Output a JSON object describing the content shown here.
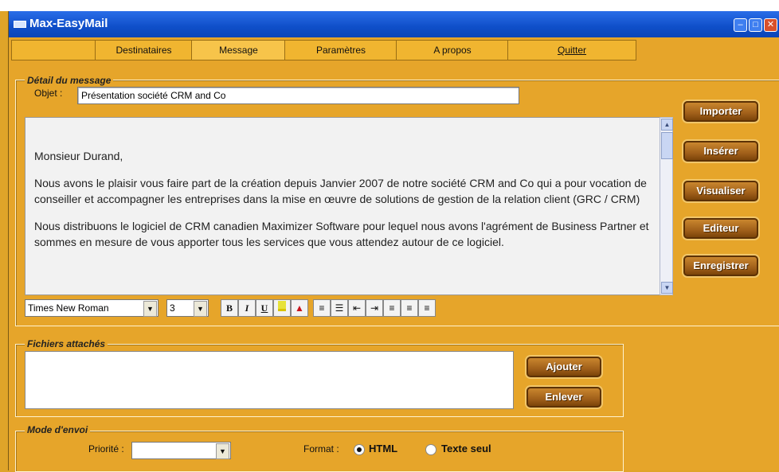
{
  "window": {
    "title": "Max-EasyMail"
  },
  "menu": {
    "items": [
      {
        "label": "Destinataires"
      },
      {
        "label": "Message"
      },
      {
        "label": "Paramètres"
      },
      {
        "label": "A propos"
      },
      {
        "label": "Quitter"
      }
    ],
    "active": "Message"
  },
  "message_detail": {
    "legend": "Détail du message",
    "subject_label": "Objet :",
    "subject_value": "Présentation société CRM and Co",
    "body_paragraphs": [
      "Monsieur Durand,",
      "Nous avons le plaisir vous faire part de la création depuis Janvier 2007 de notre  société CRM and Co qui a pour vocation de conseiller et accompagner les entreprises dans la mise en œuvre de solutions de gestion de la relation client (GRC / CRM)",
      "Nous distribuons le logiciel de CRM canadien Maximizer Software pour lequel nous avons l'agrément de Business Partner  et sommes en mesure de vous apporter tous les services que vous attendez autour de ce logiciel."
    ]
  },
  "side_buttons": {
    "importer": "Importer",
    "inserer": "Insérer",
    "visualiser": "Visualiser",
    "editeur": "Editeur",
    "enregistrer": "Enregistrer"
  },
  "format_toolbar": {
    "font_name": "Times New Roman",
    "font_size": "3",
    "buttons": [
      "B",
      "I",
      "U"
    ]
  },
  "attachments": {
    "legend": "Fichiers attachés",
    "add_label": "Ajouter",
    "remove_label": "Enlever"
  },
  "send_mode": {
    "legend": "Mode d'envoi",
    "priority_label": "Priorité :",
    "priority_value": "",
    "format_label": "Format :",
    "options": [
      "HTML",
      "Texte seul"
    ],
    "selected": "HTML"
  },
  "colors": {
    "background": "#e6a52a",
    "titlebar": "#0f4fc9",
    "button_brown": "#a1601a"
  }
}
